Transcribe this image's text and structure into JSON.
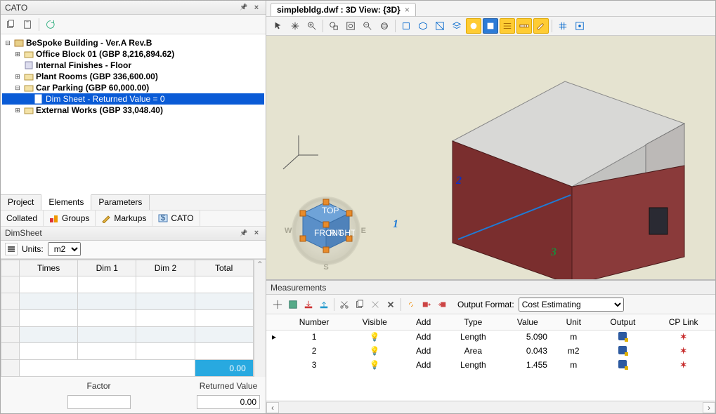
{
  "cato_panel": {
    "title": "CATO"
  },
  "tree": {
    "root": "BeSpoke Building - Ver.A Rev.B",
    "n_office": "Office Block 01 (GBP 8,216,894.62)",
    "n_finishes": "Internal Finishes - Floor",
    "n_plant": "Plant Rooms (GBP 336,600.00)",
    "n_parking": "Car Parking (GBP 60,000.00)",
    "n_dimsheet": "Dim Sheet - Returned Value = 0",
    "n_external": "External Works (GBP 33,048.40)"
  },
  "tabs": {
    "project": "Project",
    "elements": "Elements",
    "parameters": "Parameters"
  },
  "strip": {
    "collated": "Collated",
    "groups": "Groups",
    "markups": "Markups",
    "cato": "CATO"
  },
  "dimsheet": {
    "title": "DimSheet",
    "units_label": "Units:",
    "units_value": "m2",
    "col_times": "Times",
    "col_dim1": "Dim 1",
    "col_dim2": "Dim 2",
    "col_total": "Total",
    "total_value": "0.00",
    "factor_label": "Factor",
    "returned_label": "Returned Value",
    "factor_value": "",
    "returned_value": "0.00"
  },
  "doc_tab": {
    "label": "simplebldg.dwf : 3D View: {3D}"
  },
  "viewcube": {
    "front": "FRONT",
    "right": "RIGHT",
    "top": "TOP",
    "s": "S",
    "e": "E",
    "w": "W",
    "n": ""
  },
  "dims": {
    "d1": "1",
    "d2": "2",
    "d3": "3"
  },
  "measurements": {
    "title": "Measurements",
    "output_format_label": "Output Format:",
    "output_format_value": "Cost Estimating",
    "cols": {
      "number": "Number",
      "visible": "Visible",
      "add": "Add",
      "type": "Type",
      "value": "Value",
      "unit": "Unit",
      "output": "Output",
      "cplink": "CP Link"
    },
    "rows": [
      {
        "number": "1",
        "add": "Add",
        "type": "Length",
        "value": "5.090",
        "unit": "m"
      },
      {
        "number": "2",
        "add": "Add",
        "type": "Area",
        "value": "0.043",
        "unit": "m2"
      },
      {
        "number": "3",
        "add": "Add",
        "type": "Length",
        "value": "1.455",
        "unit": "m"
      }
    ]
  }
}
